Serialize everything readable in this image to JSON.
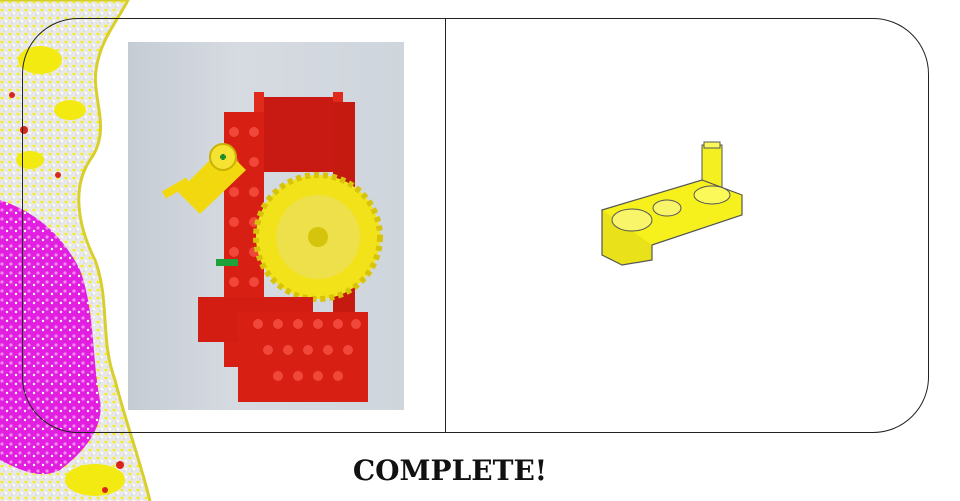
{
  "caption": "COMPLETE!",
  "icons": {
    "decoration": "colorful-texture-border",
    "photo": "red-yellow-gear-assembly-photo",
    "part": "yellow-crank-arm-part-icon"
  },
  "colors": {
    "frame": "#222222",
    "caption": "#111111",
    "brick_red": "#d81f14",
    "gear_yellow": "#f2e21a"
  }
}
